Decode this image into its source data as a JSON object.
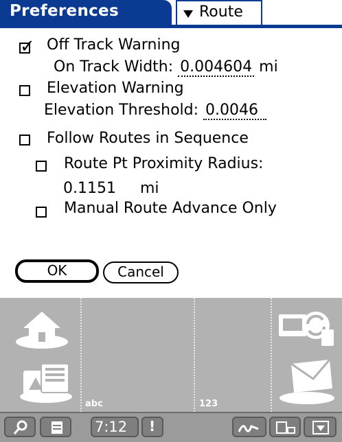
{
  "title": "Preferences",
  "category": "Route",
  "options": {
    "off_track_warning": {
      "label": "Off Track Warning",
      "checked": true
    },
    "on_track_width": {
      "label": "On Track Width:",
      "value": "0.004604",
      "unit": "mi"
    },
    "elevation_warning": {
      "label": "Elevation Warning",
      "checked": false
    },
    "elevation_threshold": {
      "label": "Elevation Threshold:",
      "value": "0.0046"
    },
    "follow_routes": {
      "label": "Follow Routes in Sequence",
      "checked": false
    },
    "route_pt_proximity": {
      "label": "Route Pt Proximity Radius:",
      "checked": false,
      "value": "0.1151",
      "unit": "mi"
    },
    "manual_route_advance": {
      "label": "Manual Route Advance Only",
      "checked": false
    }
  },
  "buttons": {
    "ok": "OK",
    "cancel": "Cancel"
  },
  "graffiti": {
    "abc_label": "abc",
    "num_label": "123"
  },
  "status": {
    "time": "7:12"
  },
  "colors": {
    "titlebar": "#0b3a92",
    "graffiti_bg": "#b2b2b2",
    "statusbar": "#9b9b9b"
  }
}
